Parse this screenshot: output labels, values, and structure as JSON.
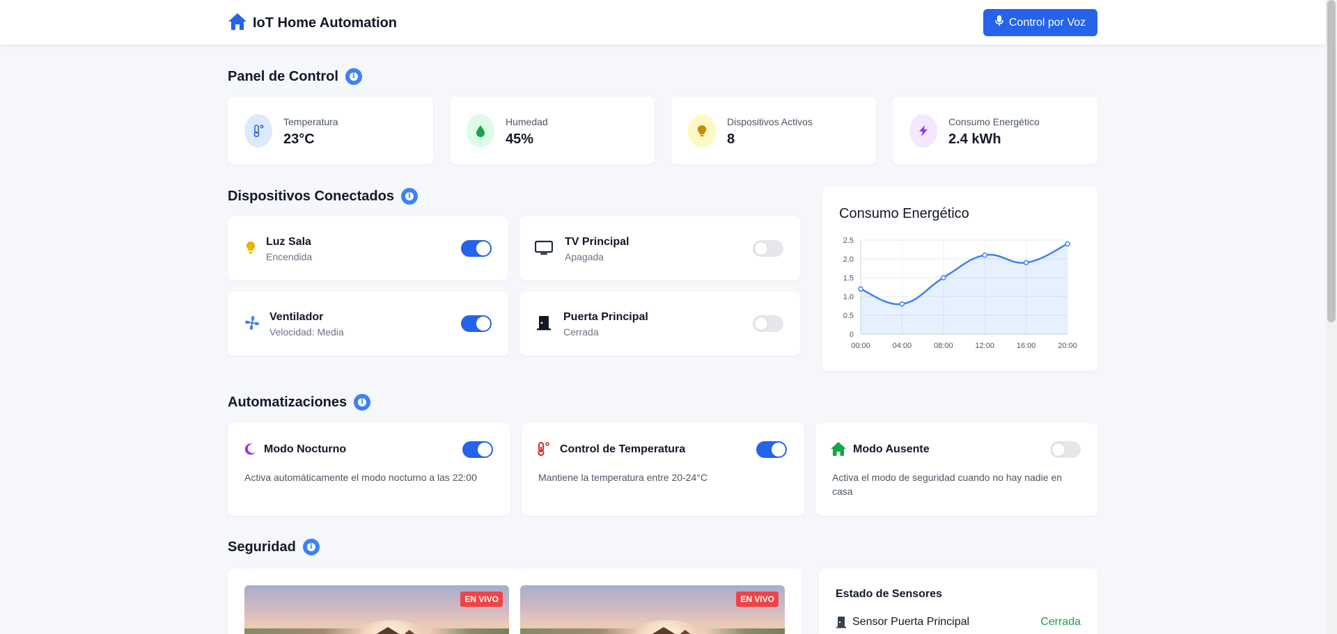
{
  "header": {
    "title": "IoT Home Automation",
    "voice_button": "Control por Voz"
  },
  "panel": {
    "title": "Panel de Control",
    "stats": [
      {
        "label": "Temperatura",
        "value": "23°C",
        "icon": "thermometer-icon",
        "color": "#2563eb",
        "bg": "#dbeafe"
      },
      {
        "label": "Humedad",
        "value": "45%",
        "icon": "droplet-icon",
        "color": "#16a34a",
        "bg": "#dcfce7"
      },
      {
        "label": "Dispositivos Activos",
        "value": "8",
        "icon": "lightbulb-icon",
        "color": "#ca8a04",
        "bg": "#fef9c3"
      },
      {
        "label": "Consumo Energético",
        "value": "2.4 kWh",
        "icon": "bolt-icon",
        "color": "#9333ea",
        "bg": "#f3e8ff"
      }
    ]
  },
  "devices": {
    "title": "Dispositivos Conectados",
    "items": [
      {
        "name": "Luz Sala",
        "status": "Encendida",
        "on": true,
        "icon": "lightbulb-icon"
      },
      {
        "name": "TV Principal",
        "status": "Apagada",
        "on": false,
        "icon": "tv-icon"
      },
      {
        "name": "Ventilador",
        "status": "Velocidad: Media",
        "on": true,
        "icon": "fan-icon"
      },
      {
        "name": "Puerta Principal",
        "status": "Cerrada",
        "on": false,
        "icon": "door-icon"
      }
    ]
  },
  "energy_chart": {
    "title": "Consumo Energético"
  },
  "chart_data": {
    "type": "line",
    "title": "Consumo Energético",
    "x": [
      "00:00",
      "04:00",
      "08:00",
      "12:00",
      "16:00",
      "20:00"
    ],
    "values": [
      1.2,
      0.8,
      1.5,
      2.1,
      1.9,
      2.4
    ],
    "y_ticks": [
      "0",
      "0.5",
      "1.0",
      "1.5",
      "2.0",
      "2.5"
    ],
    "ylim": [
      0,
      2.5
    ],
    "fill": true,
    "grid": true,
    "color": "#3b82f6"
  },
  "automations": {
    "title": "Automatizaciones",
    "items": [
      {
        "name": "Modo Nocturno",
        "desc": "Activa automáticamente el modo nocturno a las 22:00",
        "on": true,
        "icon": "moon-icon",
        "color": "#9333ea"
      },
      {
        "name": "Control de Temperatura",
        "desc": "Mantiene la temperatura entre 20-24°C",
        "on": true,
        "icon": "thermometer-icon",
        "color": "#dc2626"
      },
      {
        "name": "Modo Ausente",
        "desc": "Activa el modo de seguridad cuando no hay nadie en casa",
        "on": false,
        "icon": "home-icon",
        "color": "#16a34a"
      }
    ]
  },
  "security": {
    "title": "Seguridad",
    "cameras": [
      {
        "badge": "EN VIVO"
      },
      {
        "badge": "EN VIVO"
      }
    ],
    "sensors": {
      "title": "Estado de Sensores",
      "rows": [
        {
          "name": "Sensor Puerta Principal",
          "value": "Cerrada"
        }
      ]
    }
  }
}
